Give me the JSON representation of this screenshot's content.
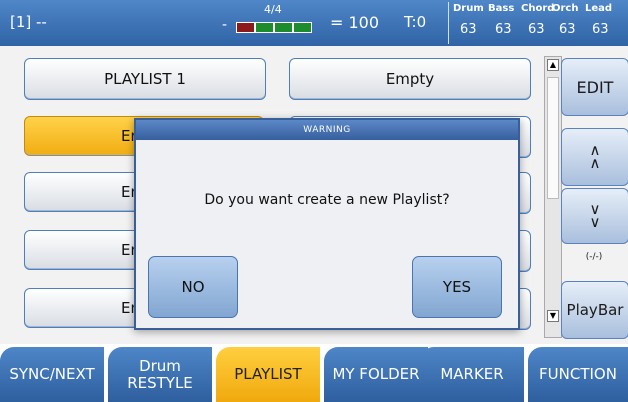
{
  "status": {
    "song": "[1] --",
    "dash": "-",
    "time_signature": "4/4",
    "tempo": "= 100",
    "transpose": "T:0",
    "mixer": [
      {
        "label": "Drum",
        "value": "63"
      },
      {
        "label": "Bass",
        "value": "63"
      },
      {
        "label": "Chord",
        "value": "63"
      },
      {
        "label": "Orch",
        "value": "63"
      },
      {
        "label": "Lead",
        "value": "63"
      }
    ],
    "beat_colors": [
      "#8c1a1a",
      "#1c8c2c",
      "#1c8c2c",
      "#1c8c2c"
    ]
  },
  "slots": {
    "left": [
      "PLAYLIST 1",
      "En",
      "En",
      "En",
      "En"
    ],
    "right": [
      "Empty",
      "",
      "",
      "",
      ""
    ]
  },
  "side": {
    "edit": "EDIT",
    "up": "∧\n∧",
    "down": "∨\n∨",
    "position": "(-/-)",
    "playbar": "PlayBar"
  },
  "tabs": [
    {
      "line1": "",
      "line2": "SYNC/NEXT"
    },
    {
      "line1": "Drum",
      "line2": "RESTYLE"
    },
    {
      "line1": "",
      "line2": "PLAYLIST"
    },
    {
      "line1": "",
      "line2": "MY FOLDER"
    },
    {
      "line1": "",
      "line2": "MARKER"
    },
    {
      "line1": "",
      "line2": "FUNCTION"
    }
  ],
  "dialog": {
    "title": "WARNING",
    "message": "Do you want create a new Playlist?",
    "no": "NO",
    "yes": "YES"
  },
  "colors": {
    "accent": "#2f63a6",
    "selected": "#f1ad12"
  }
}
